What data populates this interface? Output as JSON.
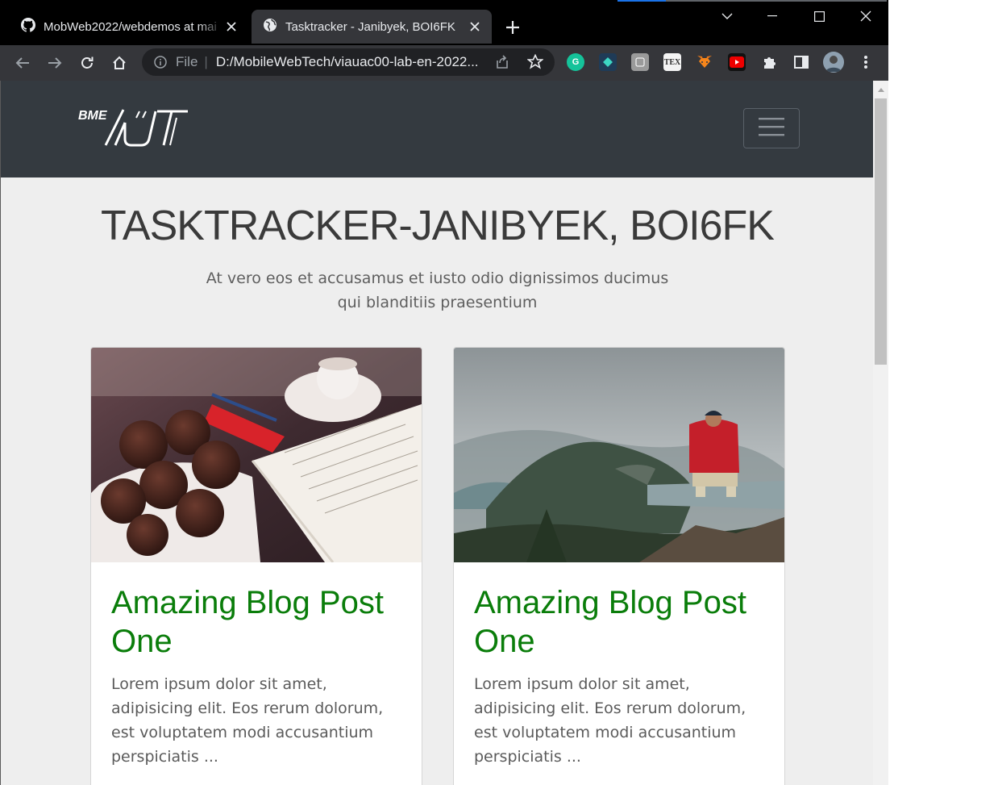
{
  "browser": {
    "tabs": [
      {
        "title": "MobWeb2022/webdemos at mai",
        "icon": "github-icon"
      },
      {
        "title": "Tasktracker - Janibyek, BOI6FK",
        "icon": "globe-icon",
        "active": true
      }
    ],
    "omnibox": {
      "scheme_label": "File",
      "url": "D:/MobileWebTech/viauac00-lab-en-2022..."
    },
    "extensions": [
      "grammarly-icon",
      "extension-diamond-icon",
      "extension-gray-icon",
      "tex-icon",
      "metamask-fox-icon",
      "youtube-icon",
      "puzzle-icon",
      "sidepanel-icon",
      "profile-avatar"
    ],
    "colors": {
      "frame": "#000000",
      "toolbar": "#35363a",
      "omnibox": "#202124"
    }
  },
  "page": {
    "logo_text": "BME AUT",
    "title": "TASKTRACKER-JANIBYEK, BOI6FK",
    "lead": "At vero eos et accusamus et iusto odio dignissimos ducimus qui blanditiis praesentium",
    "cards": [
      {
        "image": "muffins-coffee-book-photo",
        "title": "Amazing Blog Post One",
        "text": "Lorem ipsum dolor sit amet, adipisicing elit. Eos rerum dolorum, est voluptatem modi accusantium perspiciatis ..."
      },
      {
        "image": "hiker-mountain-photo",
        "title": "Amazing Blog Post One",
        "text": "Lorem ipsum dolor sit amet, adipisicing elit. Eos rerum dolorum, est voluptatem modi accusantium perspiciatis ..."
      }
    ],
    "colors": {
      "navbar": "#343a40",
      "background": "#eeeeee",
      "card_title": "#0a7d0a"
    }
  }
}
